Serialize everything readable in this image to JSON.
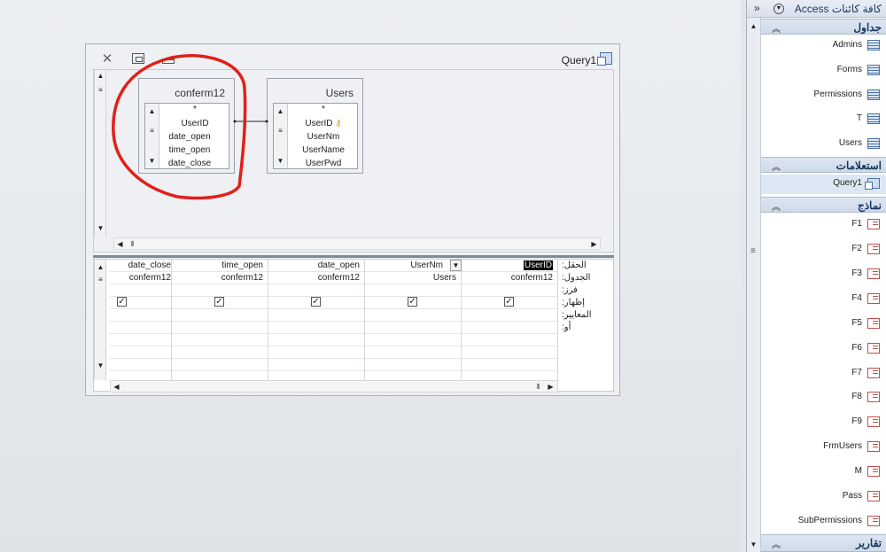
{
  "query_window": {
    "title": "Query1",
    "tables": [
      {
        "name": "conferm12",
        "fields": [
          "UserID",
          "date_open",
          "time_open",
          "date_close"
        ]
      },
      {
        "name": "Users",
        "fields": [
          "UserID",
          "UserNm",
          "UserName",
          "UserPwd"
        ]
      }
    ],
    "grid": {
      "row_labels": [
        "الحقل:",
        "الجدول:",
        "فرز:",
        "إظهار:",
        "المعايير:",
        "أو:"
      ],
      "columns": [
        {
          "field": "UserID",
          "table": "conferm12",
          "show": true,
          "selected": true
        },
        {
          "field": "UserNm",
          "table": "Users",
          "show": true,
          "dropdown": true
        },
        {
          "field": "date_open",
          "table": "conferm12",
          "show": true
        },
        {
          "field": "time_open",
          "table": "conferm12",
          "show": true
        },
        {
          "field": "date_close",
          "table": "conferm12",
          "show": true
        }
      ]
    }
  },
  "nav": {
    "title": "كافة كائنات Access",
    "groups": {
      "tables": {
        "label": "جداول",
        "items": [
          "Admins",
          "Forms",
          "Permissions",
          "T",
          "Users"
        ]
      },
      "queries": {
        "label": "استعلامات",
        "items": [
          "Query1"
        ]
      },
      "forms": {
        "label": "نماذج",
        "items": [
          "F1",
          "F2",
          "F3",
          "F4",
          "F5",
          "F6",
          "F7",
          "F8",
          "F9",
          "FrmUsers",
          "M",
          "Pass",
          "SubPermissions"
        ]
      },
      "reports": {
        "label": "تقارير"
      }
    }
  },
  "colors": {
    "annotation": "#e0201a",
    "accent": "#4a6fa5"
  }
}
